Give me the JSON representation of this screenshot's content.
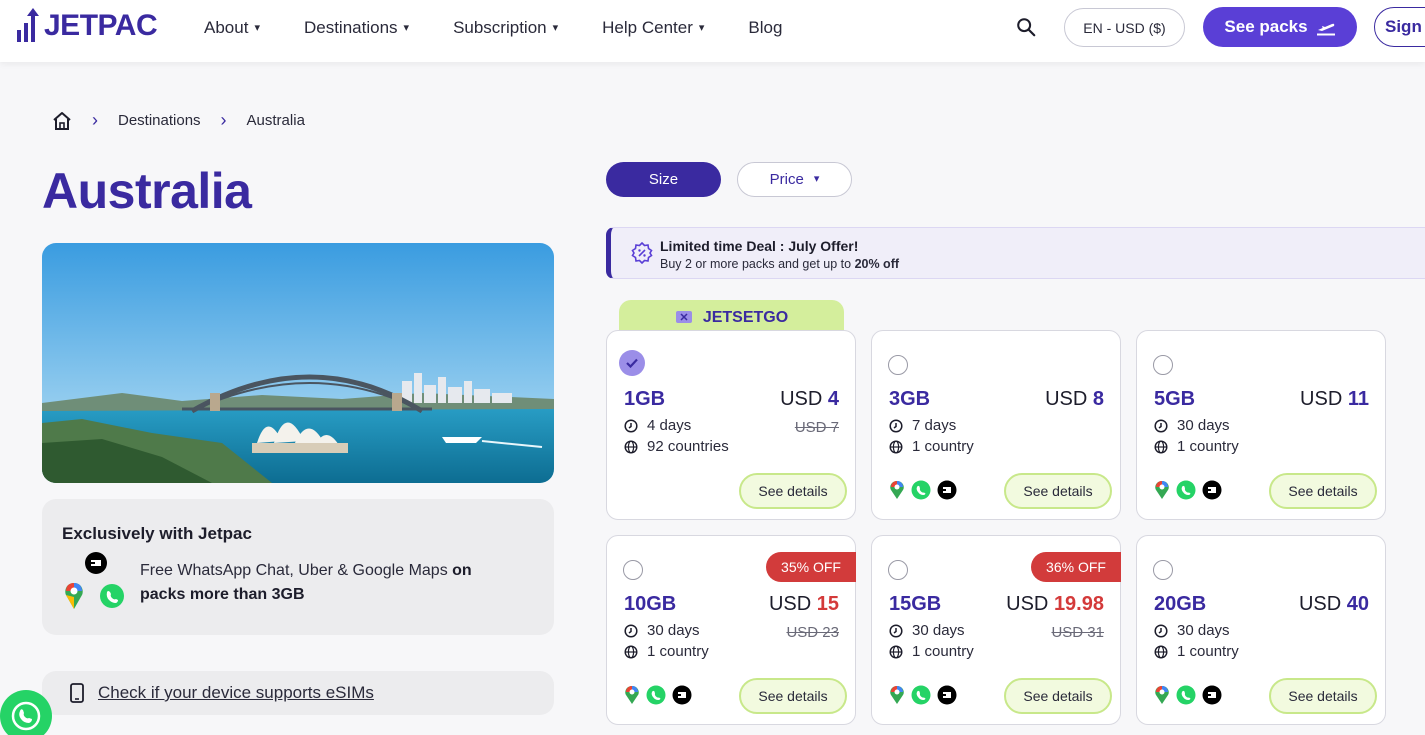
{
  "header": {
    "logo": "JETPAC",
    "nav": [
      {
        "label": "About",
        "dropdown": true
      },
      {
        "label": "Destinations",
        "dropdown": true
      },
      {
        "label": "Subscription",
        "dropdown": true
      },
      {
        "label": "Help Center",
        "dropdown": true
      },
      {
        "label": "Blog",
        "dropdown": false
      }
    ],
    "language": "EN - USD ($)",
    "cta": "See packs",
    "sign_in": "Sign in"
  },
  "breadcrumb": {
    "items": [
      "Destinations",
      "Australia"
    ]
  },
  "page_title": "Australia",
  "exclusive": {
    "title": "Exclusively with Jetpac",
    "text_plain": "Free WhatsApp Chat, Uber & Google Maps ",
    "text_bold": "on packs more than 3GB"
  },
  "device_check": "Check if your device supports eSIMs",
  "filters": {
    "size": "Size",
    "price": "Price"
  },
  "deal": {
    "title": "Limited time Deal : July Offer!",
    "subtitle_plain": "Buy 2 or more packs and get up to ",
    "subtitle_bold": "20% off"
  },
  "promo_tag": "JETSETGO",
  "see_details": "See details",
  "packs": [
    {
      "size": "1GB",
      "currency": "USD",
      "price": "4",
      "old_price": "USD 7",
      "days": "4 days",
      "coverage": "92 countries",
      "selected": true,
      "discount": "",
      "apps": false
    },
    {
      "size": "3GB",
      "currency": "USD",
      "price": "8",
      "old_price": "",
      "days": "7 days",
      "coverage": "1 country",
      "selected": false,
      "discount": "",
      "apps": true
    },
    {
      "size": "5GB",
      "currency": "USD",
      "price": "11",
      "old_price": "",
      "days": "30 days",
      "coverage": "1 country",
      "selected": false,
      "discount": "",
      "apps": true
    },
    {
      "size": "10GB",
      "currency": "USD",
      "price": "15",
      "old_price": "USD 23",
      "days": "30 days",
      "coverage": "1 country",
      "selected": false,
      "discount": "35% OFF",
      "apps": true
    },
    {
      "size": "15GB",
      "currency": "USD",
      "price": "19.98",
      "old_price": "USD 31",
      "days": "30 days",
      "coverage": "1 country",
      "selected": false,
      "discount": "36% OFF",
      "apps": true
    },
    {
      "size": "20GB",
      "currency": "USD",
      "price": "40",
      "old_price": "",
      "days": "30 days",
      "coverage": "1 country",
      "selected": false,
      "discount": "",
      "apps": true
    }
  ],
  "colors": {
    "brand": "#3a2aa0",
    "accent": "#5a3fd6",
    "discount": "#d23b3b",
    "promo": "#d4ee9c"
  }
}
